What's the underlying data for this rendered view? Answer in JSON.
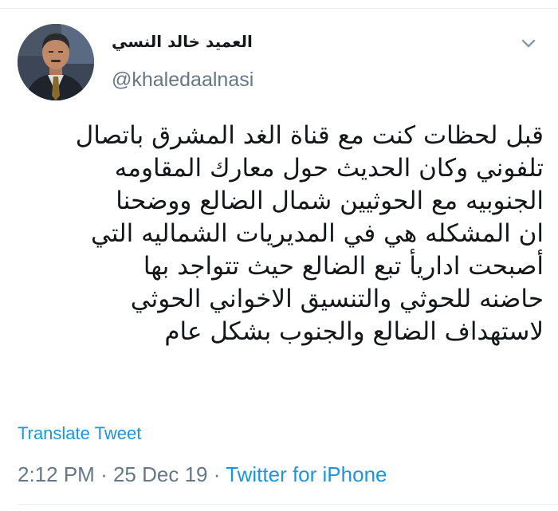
{
  "author": {
    "display_name": "العميد خالد النسي",
    "handle": "@khaledaalnasi"
  },
  "menu": {
    "caret_icon": "chevron-down-icon"
  },
  "tweet": {
    "lines": [
      "قبل لحظات كنت مع قناة الغد المشرق باتصال",
      "تلفوني وكان الحديث حول معارك المقاومه",
      "الجنوبيه مع الحوثيين شمال الضالع ووضحنا",
      "ان المشكله هي في المديريات الشماليه التي",
      "أصبحت اداريأ تبع الضالع حيث تتواجد بها",
      "حاضنه للحوثي والتنسيق الاخواني الحوثي",
      "لاستهداف الضالع والجنوب بشكل عام"
    ],
    "translate_label": "Translate Tweet",
    "time": "2:12 PM",
    "date": "25 Dec 19",
    "separator": "·",
    "source": "Twitter for iPhone"
  },
  "colors": {
    "link": "#1b95e0",
    "secondary_text": "#657786",
    "primary_text": "#14171a",
    "divider": "#e6ecf0"
  }
}
